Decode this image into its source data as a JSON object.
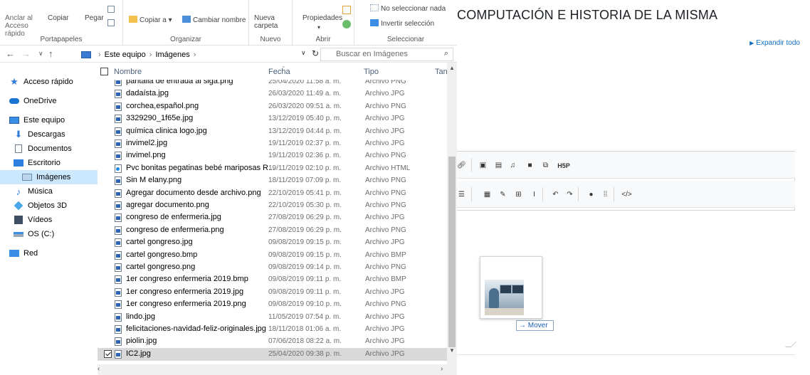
{
  "web": {
    "title": "COMPUTACIÓN E HISTORIA DE LA MISMA",
    "expand_all": "Expandir todo",
    "move_tip": "→ Mover"
  },
  "ribbon": {
    "clipboard": {
      "pin_label": "Anclar al Acceso rápido",
      "copy_label": "Copiar",
      "paste_label": "Pegar",
      "group": "Portapapeles"
    },
    "organize": {
      "copy_to": "Copiar a ▾",
      "rename": "Cambiar nombre",
      "group": "Organizar"
    },
    "new": {
      "new_folder": "Nueva carpeta",
      "group": "Nuevo"
    },
    "open": {
      "properties": "Propiedades",
      "group": "Abrir"
    },
    "select": {
      "select_none": "No seleccionar nada",
      "invert": "Invertir selección",
      "group": "Seleccionar"
    }
  },
  "address": {
    "crumbs": [
      "Este equipo",
      "Imágenes"
    ],
    "search_placeholder": "Buscar en Imágenes"
  },
  "nav": [
    {
      "label": "Acceso rápido",
      "icon": "star-icon"
    },
    {
      "label": "OneDrive",
      "icon": "cloud-icon"
    },
    {
      "label": "Este equipo",
      "icon": "computer-icon"
    },
    {
      "label": "Descargas",
      "icon": "download-icon"
    },
    {
      "label": "Documentos",
      "icon": "document-icon"
    },
    {
      "label": "Escritorio",
      "icon": "desktop-icon"
    },
    {
      "label": "Imágenes",
      "icon": "pictures-icon"
    },
    {
      "label": "Música",
      "icon": "music-icon"
    },
    {
      "label": "Objetos 3D",
      "icon": "cube-icon"
    },
    {
      "label": "Vídeos",
      "icon": "video-icon"
    },
    {
      "label": "OS (C:)",
      "icon": "drive-icon"
    },
    {
      "label": "Red",
      "icon": "network-icon"
    }
  ],
  "columns": {
    "name": "Nombre",
    "date": "Fecha",
    "type": "Tipo",
    "size": "Tan"
  },
  "files": [
    {
      "name": "pantalla de entrada al siga.png",
      "date": "25/04/2020 11:58 a. m.",
      "type": "Archivo PNG"
    },
    {
      "name": "dadaísta.jpg",
      "date": "26/03/2020 11:49 a. m.",
      "type": "Archivo JPG"
    },
    {
      "name": "corchea,español.png",
      "date": "26/03/2020 09:51 a. m.",
      "type": "Archivo PNG"
    },
    {
      "name": "3329290_1f65e.jpg",
      "date": "13/12/2019 05:40 p. m.",
      "type": "Archivo JPG"
    },
    {
      "name": "química clinica logo.jpg",
      "date": "13/12/2019 04:44 p. m.",
      "type": "Archivo JPG"
    },
    {
      "name": "invimel2.jpg",
      "date": "19/11/2019 02:37 p. m.",
      "type": "Archivo JPG"
    },
    {
      "name": "invimel.png",
      "date": "19/11/2019 02:36 p. m.",
      "type": "Archivo PNG"
    },
    {
      "name": "Pvc bonitas pegatinas bebé mariposas R...",
      "date": "19/11/2019 02:10 p. m.",
      "type": "Archivo HTML"
    },
    {
      "name": "Sin M elany.png",
      "date": "18/11/2019 07:09 p. m.",
      "type": "Archivo PNG"
    },
    {
      "name": "Agregar documento desde archivo.png",
      "date": "22/10/2019 05:41 p. m.",
      "type": "Archivo PNG"
    },
    {
      "name": "agregar documento.png",
      "date": "22/10/2019 05:30 p. m.",
      "type": "Archivo PNG"
    },
    {
      "name": "congreso de enfermeria.jpg",
      "date": "27/08/2019 06:29 p. m.",
      "type": "Archivo JPG"
    },
    {
      "name": "congreso de enfermeria.png",
      "date": "27/08/2019 06:29 p. m.",
      "type": "Archivo PNG"
    },
    {
      "name": "cartel gongreso.jpg",
      "date": "09/08/2019 09:15 p. m.",
      "type": "Archivo JPG"
    },
    {
      "name": "cartel gongreso.bmp",
      "date": "09/08/2019 09:15 p. m.",
      "type": "Archivo BMP"
    },
    {
      "name": "cartel gongreso.png",
      "date": "09/08/2019 09:14 p. m.",
      "type": "Archivo PNG"
    },
    {
      "name": "1er congreso enfermeria 2019.bmp",
      "date": "09/08/2019 09:11 p. m.",
      "type": "Archivo BMP"
    },
    {
      "name": "1er congreso enfermeria 2019.jpg",
      "date": "09/08/2019 09:11 p. m.",
      "type": "Archivo JPG"
    },
    {
      "name": "1er congreso enfermeria 2019.png",
      "date": "09/08/2019 09:10 p. m.",
      "type": "Archivo PNG"
    },
    {
      "name": "lindo.jpg",
      "date": "11/05/2019 07:54 p. m.",
      "type": "Archivo JPG"
    },
    {
      "name": "felicitaciones-navidad-feliz-originales.jpg",
      "date": "18/11/2018 01:06 a. m.",
      "type": "Archivo JPG"
    },
    {
      "name": "piolin.jpg",
      "date": "07/06/2018 08:22 a. m.",
      "type": "Archivo JPG"
    },
    {
      "name": "IC2.jpg",
      "date": "25/04/2020 09:38 p. m.",
      "type": "Archivo JPG",
      "selected": true
    }
  ],
  "editor_toolbar": {
    "row1": [
      "link-icon",
      "image-icon",
      "media-icon",
      "microphone-icon",
      "video-camera-icon",
      "copy-icon",
      "h5p-icon"
    ],
    "row1_h5p_label": "H5P",
    "row2": [
      "indent-icon",
      "calculator-icon",
      "edit-icon",
      "table-icon",
      "text-cursor-icon",
      "undo-icon",
      "redo-icon",
      "accessibility-icon",
      "screenreader-icon",
      "html-icon"
    ]
  },
  "colors": {
    "accent_blue": "#0f6cbf",
    "selected_nav": "#cce8ff",
    "selected_row": "#d9d9d9"
  }
}
